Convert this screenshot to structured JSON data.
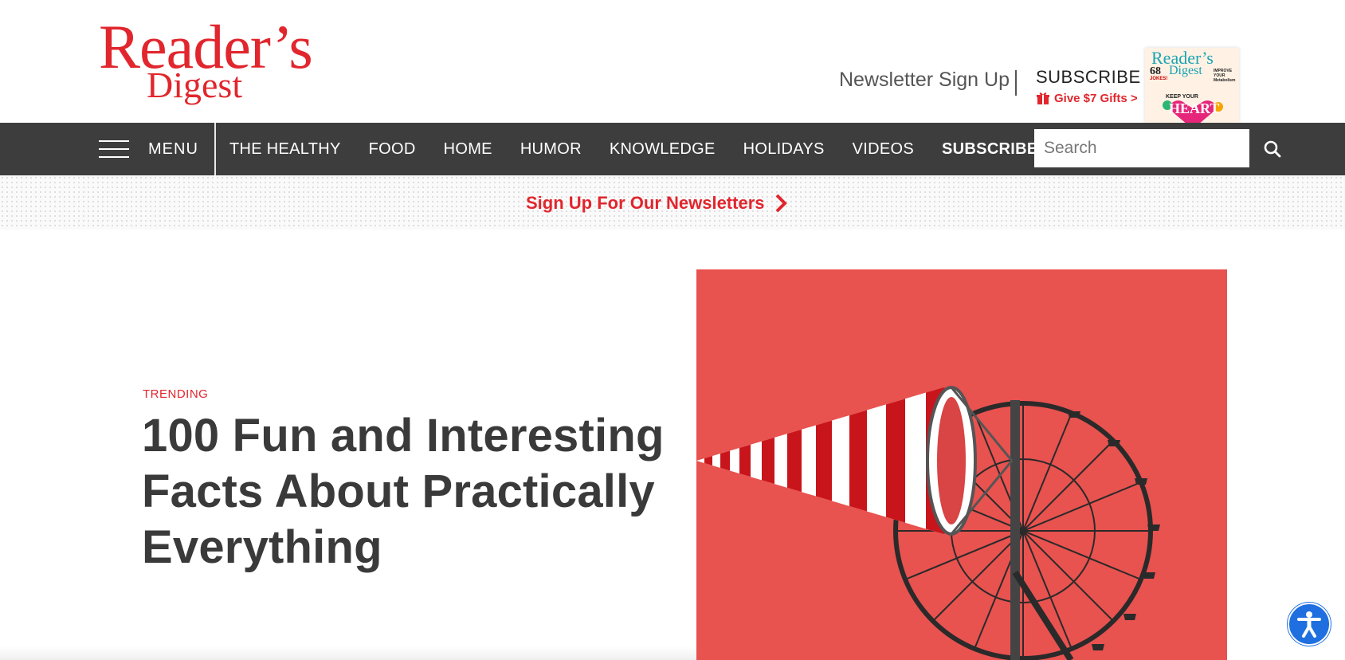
{
  "header": {
    "logo_line1": "Reader’s",
    "logo_line2": "Digest",
    "newsletter_link": "Newsletter Sign Up",
    "subscribe_title": "SUBSCRIBE",
    "gift_text": "Give $7 Gifts >",
    "magazine": {
      "title": "Reader’s",
      "subtitle": "Digest",
      "number": "68",
      "jokes": "JOKES!",
      "side_text": "IMPROVE YOUR Metabolism",
      "keep": "KEEP YOUR",
      "heart": "HEART"
    }
  },
  "nav": {
    "menu_label": "MENU",
    "links": [
      "THE HEALTHY",
      "FOOD",
      "HOME",
      "HUMOR",
      "KNOWLEDGE",
      "HOLIDAYS",
      "VIDEOS"
    ],
    "subscribe": "SUBSCRIBE",
    "search_placeholder": "Search"
  },
  "newsletter_strip": {
    "cta": "Sign Up For Our Newsletters"
  },
  "hero": {
    "kicker": "TRENDING",
    "headline": "100 Fun and Interesting Facts About Practically Everything"
  },
  "colors": {
    "brand_red": "#e1262d",
    "nav_bg": "#3d3d3d",
    "hero_bg": "#e8524f",
    "accessibility_blue": "#1f6fe0"
  },
  "icons": [
    "hamburger-icon",
    "search-icon",
    "gift-icon",
    "chevron-right-icon",
    "accessibility-icon"
  ]
}
